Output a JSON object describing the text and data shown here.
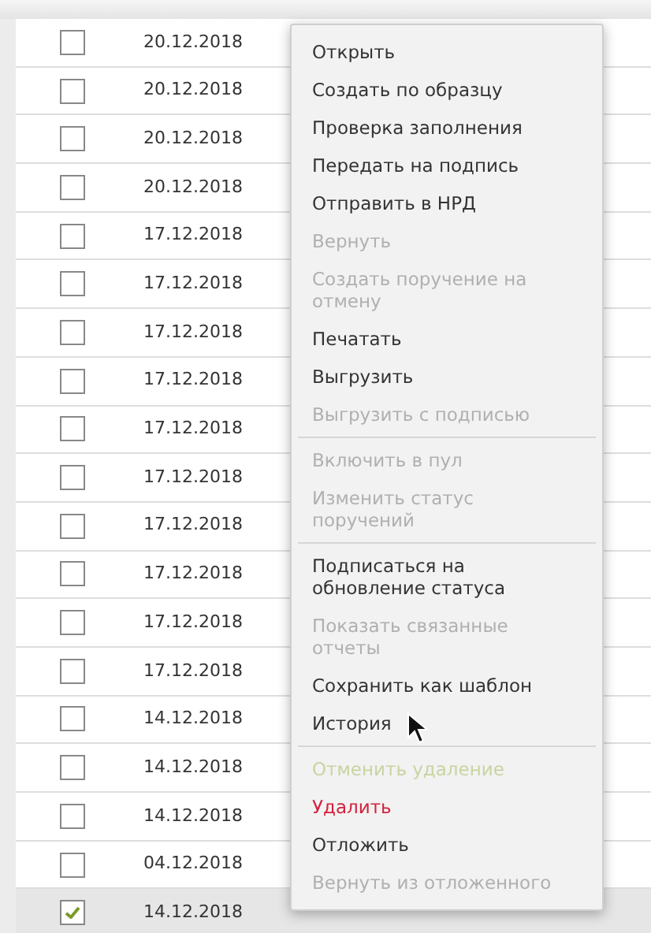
{
  "rows": [
    {
      "date": "20.12.2018",
      "checked": false,
      "selected": false
    },
    {
      "date": "20.12.2018",
      "checked": false,
      "selected": false
    },
    {
      "date": "20.12.2018",
      "checked": false,
      "selected": false
    },
    {
      "date": "20.12.2018",
      "checked": false,
      "selected": false
    },
    {
      "date": "17.12.2018",
      "checked": false,
      "selected": false
    },
    {
      "date": "17.12.2018",
      "checked": false,
      "selected": false
    },
    {
      "date": "17.12.2018",
      "checked": false,
      "selected": false
    },
    {
      "date": "17.12.2018",
      "checked": false,
      "selected": false
    },
    {
      "date": "17.12.2018",
      "checked": false,
      "selected": false
    },
    {
      "date": "17.12.2018",
      "checked": false,
      "selected": false
    },
    {
      "date": "17.12.2018",
      "checked": false,
      "selected": false
    },
    {
      "date": "17.12.2018",
      "checked": false,
      "selected": false
    },
    {
      "date": "17.12.2018",
      "checked": false,
      "selected": false
    },
    {
      "date": "17.12.2018",
      "checked": false,
      "selected": false
    },
    {
      "date": "14.12.2018",
      "checked": false,
      "selected": false
    },
    {
      "date": "14.12.2018",
      "checked": false,
      "selected": false
    },
    {
      "date": "14.12.2018",
      "checked": false,
      "selected": false
    },
    {
      "date": "04.12.2018",
      "checked": false,
      "selected": false
    },
    {
      "date": "14.12.2018",
      "checked": true,
      "selected": true
    }
  ],
  "context_menu": {
    "groups": [
      {
        "items": [
          {
            "label": "Открыть",
            "kind": "action",
            "disabled": false
          },
          {
            "label": "Создать по образцу",
            "kind": "action",
            "disabled": false
          },
          {
            "label": "Проверка заполнения",
            "kind": "action",
            "disabled": false
          },
          {
            "label": "Передать на подпись",
            "kind": "action",
            "disabled": false
          },
          {
            "label": "Отправить в НРД",
            "kind": "action",
            "disabled": false
          },
          {
            "label": "Вернуть",
            "kind": "action",
            "disabled": true
          },
          {
            "label": "Создать поручение на отмену",
            "kind": "action",
            "disabled": true
          },
          {
            "label": "Печатать",
            "kind": "action",
            "disabled": false
          },
          {
            "label": "Выгрузить",
            "kind": "action",
            "disabled": false
          },
          {
            "label": "Выгрузить с подписью",
            "kind": "action",
            "disabled": true
          }
        ]
      },
      {
        "items": [
          {
            "label": "Включить в пул",
            "kind": "action",
            "disabled": true
          },
          {
            "label": "Изменить статус поручений",
            "kind": "action",
            "disabled": true
          }
        ]
      },
      {
        "items": [
          {
            "label": "Подписаться на обновление статуса",
            "kind": "action",
            "disabled": false
          },
          {
            "label": "Показать связанные отчеты",
            "kind": "action",
            "disabled": true
          },
          {
            "label": "Сохранить как шаблон",
            "kind": "action",
            "disabled": false
          },
          {
            "label": "История",
            "kind": "action",
            "disabled": false
          }
        ]
      },
      {
        "items": [
          {
            "label": "Отменить удаление",
            "kind": "undo",
            "disabled": true
          },
          {
            "label": "Удалить",
            "kind": "danger",
            "disabled": false
          },
          {
            "label": "Отложить",
            "kind": "action",
            "disabled": false
          },
          {
            "label": "Вернуть из отложенного",
            "kind": "action",
            "disabled": true
          }
        ]
      }
    ]
  }
}
